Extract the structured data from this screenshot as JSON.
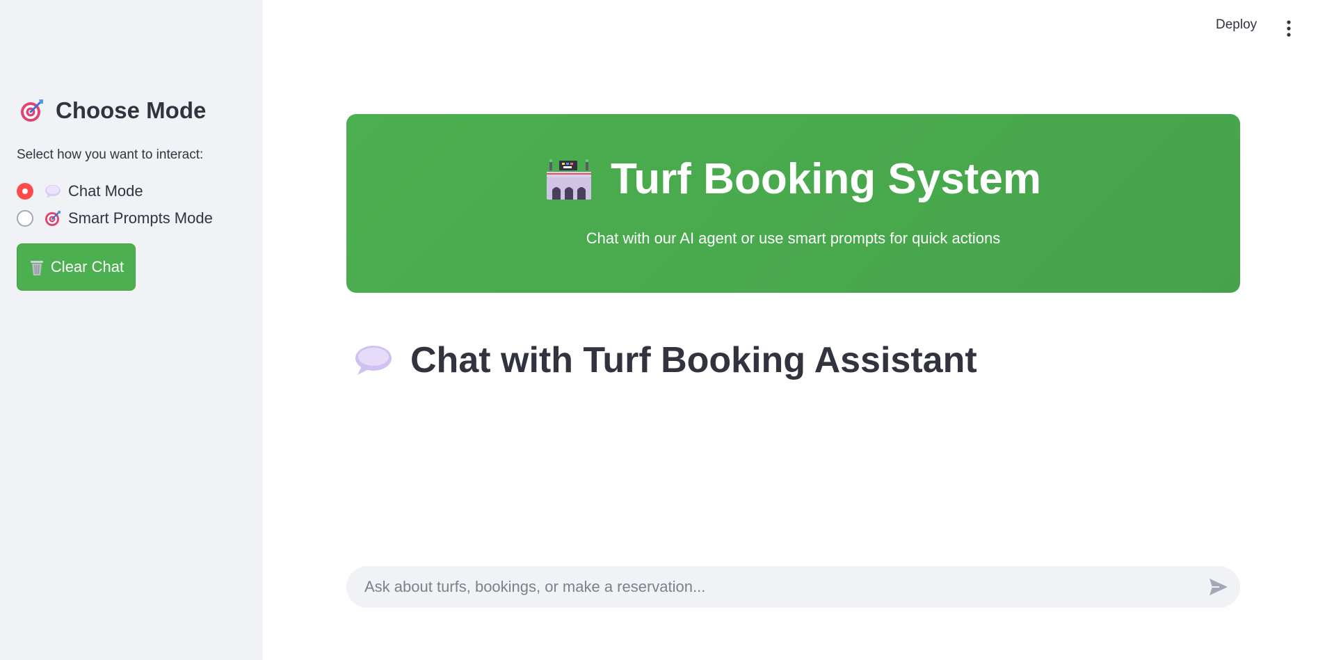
{
  "sidebar": {
    "title": "Choose Mode",
    "description": "Select how you want to interact:",
    "options": [
      {
        "label": "Chat Mode",
        "selected": true,
        "icon": "speech-bubble-icon"
      },
      {
        "label": "Smart Prompts Mode",
        "selected": false,
        "icon": "target-icon"
      }
    ],
    "clear_button": "Clear Chat"
  },
  "header": {
    "deploy_label": "Deploy"
  },
  "hero": {
    "title": "Turf Booking System",
    "subtitle": "Chat with our AI agent or use smart prompts for quick actions"
  },
  "chat": {
    "heading": "Chat with Turf Booking Assistant",
    "input_placeholder": "Ask about turfs, bookings, or make a reservation..."
  },
  "colors": {
    "accent_green": "#4caf50",
    "radio_red": "#ff4b4b",
    "sidebar_bg": "#f0f2f6"
  }
}
